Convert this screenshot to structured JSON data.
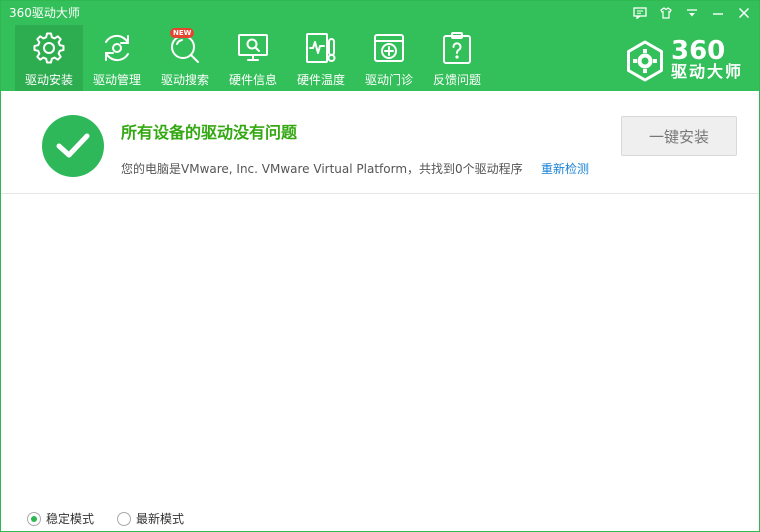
{
  "window": {
    "title": "360驱动大师",
    "controls": [
      "chat-icon",
      "skin-icon",
      "menu-icon",
      "minimize-icon",
      "close-icon"
    ]
  },
  "toolbar": {
    "items": [
      {
        "label": "驱动安装",
        "icon": "gear-icon",
        "active": true
      },
      {
        "label": "驱动管理",
        "icon": "refresh-icon",
        "active": false
      },
      {
        "label": "驱动搜索",
        "icon": "search-icon",
        "active": false,
        "badge": "NEW"
      },
      {
        "label": "硬件信息",
        "icon": "monitor-icon",
        "active": false
      },
      {
        "label": "硬件温度",
        "icon": "thermometer-icon",
        "active": false
      },
      {
        "label": "驱动门诊",
        "icon": "clinic-icon",
        "active": false
      },
      {
        "label": "反馈问题",
        "icon": "feedback-icon",
        "active": false
      }
    ]
  },
  "brand": {
    "number": "360",
    "name": "驱动大师"
  },
  "status": {
    "title": "所有设备的驱动没有问题",
    "detail": "您的电脑是VMware, Inc. VMware Virtual Platform，共找到0个驱动程序",
    "rescan_label": "重新检测",
    "install_label": "一键安装"
  },
  "footer": {
    "modes": [
      {
        "label": "稳定模式",
        "checked": true
      },
      {
        "label": "最新模式",
        "checked": false
      }
    ]
  },
  "colors": {
    "header_green": "#33c05a",
    "success_green": "#2fb85a",
    "title_green": "#34a812",
    "link_blue": "#1a82d6"
  }
}
